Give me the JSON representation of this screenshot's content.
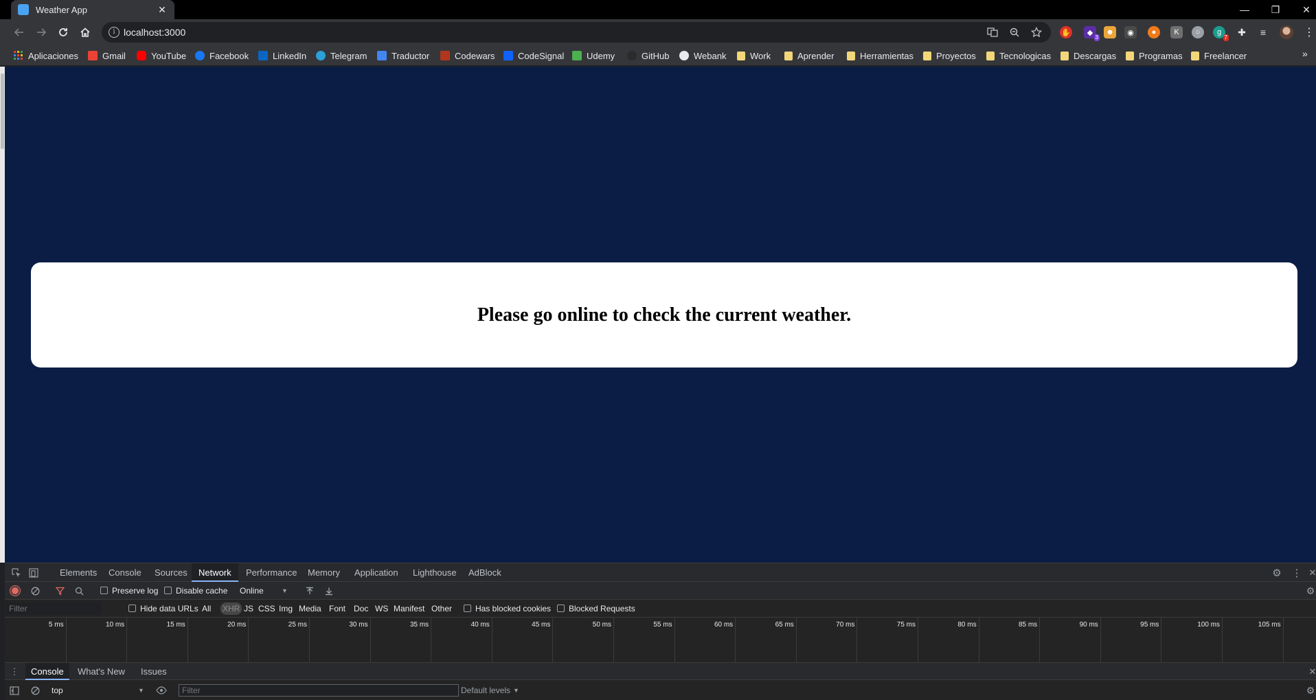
{
  "browser": {
    "tab_title": "Weather App",
    "tab_close": "✕",
    "url": "localhost:3000",
    "window_controls": {
      "minimize": "—",
      "restore": "❐",
      "close": "✕"
    }
  },
  "bookmarks": [
    {
      "label": "Aplicaciones",
      "icon": "apps-grid-icon",
      "color": "#e8eaed"
    },
    {
      "label": "Gmail",
      "icon": "gmail-icon",
      "color": "#ea4335"
    },
    {
      "label": "YouTube",
      "icon": "youtube-icon",
      "color": "#ff0000"
    },
    {
      "label": "Facebook",
      "icon": "facebook-icon",
      "color": "#1877f2"
    },
    {
      "label": "LinkedIn",
      "icon": "linkedin-icon",
      "color": "#0a66c2"
    },
    {
      "label": "Telegram",
      "icon": "telegram-icon",
      "color": "#2aa1da"
    },
    {
      "label": "Traductor",
      "icon": "translate-icon",
      "color": "#4285f4"
    },
    {
      "label": "Codewars",
      "icon": "codewars-icon",
      "color": "#b1361e"
    },
    {
      "label": "CodeSignal",
      "icon": "codesignal-icon",
      "color": "#1062fb"
    },
    {
      "label": "Udemy",
      "icon": "udemy-icon",
      "color": "#4caf50"
    },
    {
      "label": "GitHub",
      "icon": "github-icon",
      "color": "#2b2b2b"
    },
    {
      "label": "Webank",
      "icon": "globe-icon",
      "color": "#e8eaed"
    },
    {
      "label": "Work",
      "icon": "folder-icon",
      "color": "#f2d77a"
    },
    {
      "label": "Aprender",
      "icon": "folder-icon",
      "color": "#f2d77a"
    },
    {
      "label": "Herramientas",
      "icon": "folder-icon",
      "color": "#f2d77a"
    },
    {
      "label": "Proyectos",
      "icon": "folder-icon",
      "color": "#f2d77a"
    },
    {
      "label": "Tecnologicas",
      "icon": "folder-icon",
      "color": "#f2d77a"
    },
    {
      "label": "Descargas",
      "icon": "folder-icon",
      "color": "#f2d77a"
    },
    {
      "label": "Programas",
      "icon": "folder-icon",
      "color": "#f2d77a"
    },
    {
      "label": "Freelancer",
      "icon": "folder-icon",
      "color": "#f2d77a"
    }
  ],
  "extensions": {
    "badge_3": "3",
    "badge_7": "7"
  },
  "page": {
    "background": "#0b1d45",
    "message": "Please go online to check the current weather."
  },
  "devtools": {
    "tabs": [
      "Elements",
      "Console",
      "Sources",
      "Network",
      "Performance",
      "Memory",
      "Application",
      "Lighthouse",
      "AdBlock"
    ],
    "active_tab": "Network",
    "network_toolbar": {
      "preserve_log": "Preserve log",
      "disable_cache": "Disable cache",
      "throttling": "Online"
    },
    "filter_bar": {
      "placeholder": "Filter",
      "hide_data_urls": "Hide data URLs",
      "types": [
        "All",
        "XHR",
        "JS",
        "CSS",
        "Img",
        "Media",
        "Font",
        "Doc",
        "WS",
        "Manifest",
        "Other"
      ],
      "selected_type": "XHR",
      "has_blocked_cookies": "Has blocked cookies",
      "blocked_requests": "Blocked Requests"
    },
    "timeline_ticks": [
      "5 ms",
      "10 ms",
      "15 ms",
      "20 ms",
      "25 ms",
      "30 ms",
      "35 ms",
      "40 ms",
      "45 ms",
      "50 ms",
      "55 ms",
      "60 ms",
      "65 ms",
      "70 ms",
      "75 ms",
      "80 ms",
      "85 ms",
      "90 ms",
      "95 ms",
      "100 ms",
      "105 ms"
    ],
    "drawer_tabs": [
      "Console",
      "What's New",
      "Issues"
    ],
    "drawer_active": "Console",
    "console": {
      "context": "top",
      "filter_placeholder": "Filter",
      "levels": "Default levels"
    }
  }
}
